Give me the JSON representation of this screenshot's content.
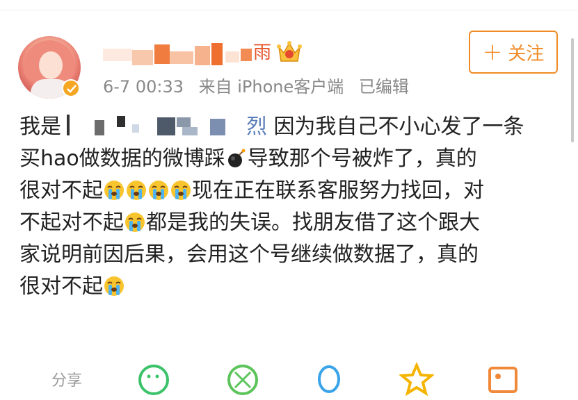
{
  "post": {
    "username_visible_suffix": "雨",
    "timestamp": "6-7 00:33",
    "source": "来自 iPhone客户端",
    "edited": "已编辑",
    "follow_label": "关注",
    "follow_plus": "+",
    "text": {
      "line1_prefix": "我是",
      "line1_mention_tail": "烈",
      "line1_suffix": " 因为我自己不小心发了一条",
      "line2_a": "买hao做数据的微博踩",
      "line2_b": "导致那个号被炸了，真的",
      "line3_a": "很对不起",
      "line3_b": "现在正在联系客服努力找回，对",
      "line4_a": "不起对不起",
      "line4_b": "都是我的失误。找朋友借了这个跟大",
      "line5": "家说明前因后果，会用这个号继续做数据了，真的",
      "line6": "很对不起"
    }
  },
  "action_bar": {
    "share_label": "分享"
  },
  "colors": {
    "accent": "#f18b26",
    "username": "#e4582c",
    "mention": "#5a7db9",
    "meta": "#888888"
  },
  "icons": [
    "verified-icon",
    "crown-icon",
    "bomb-icon",
    "crying-emoji",
    "wechat-icon",
    "moments-icon",
    "qq-icon",
    "star-icon",
    "image-icon"
  ]
}
